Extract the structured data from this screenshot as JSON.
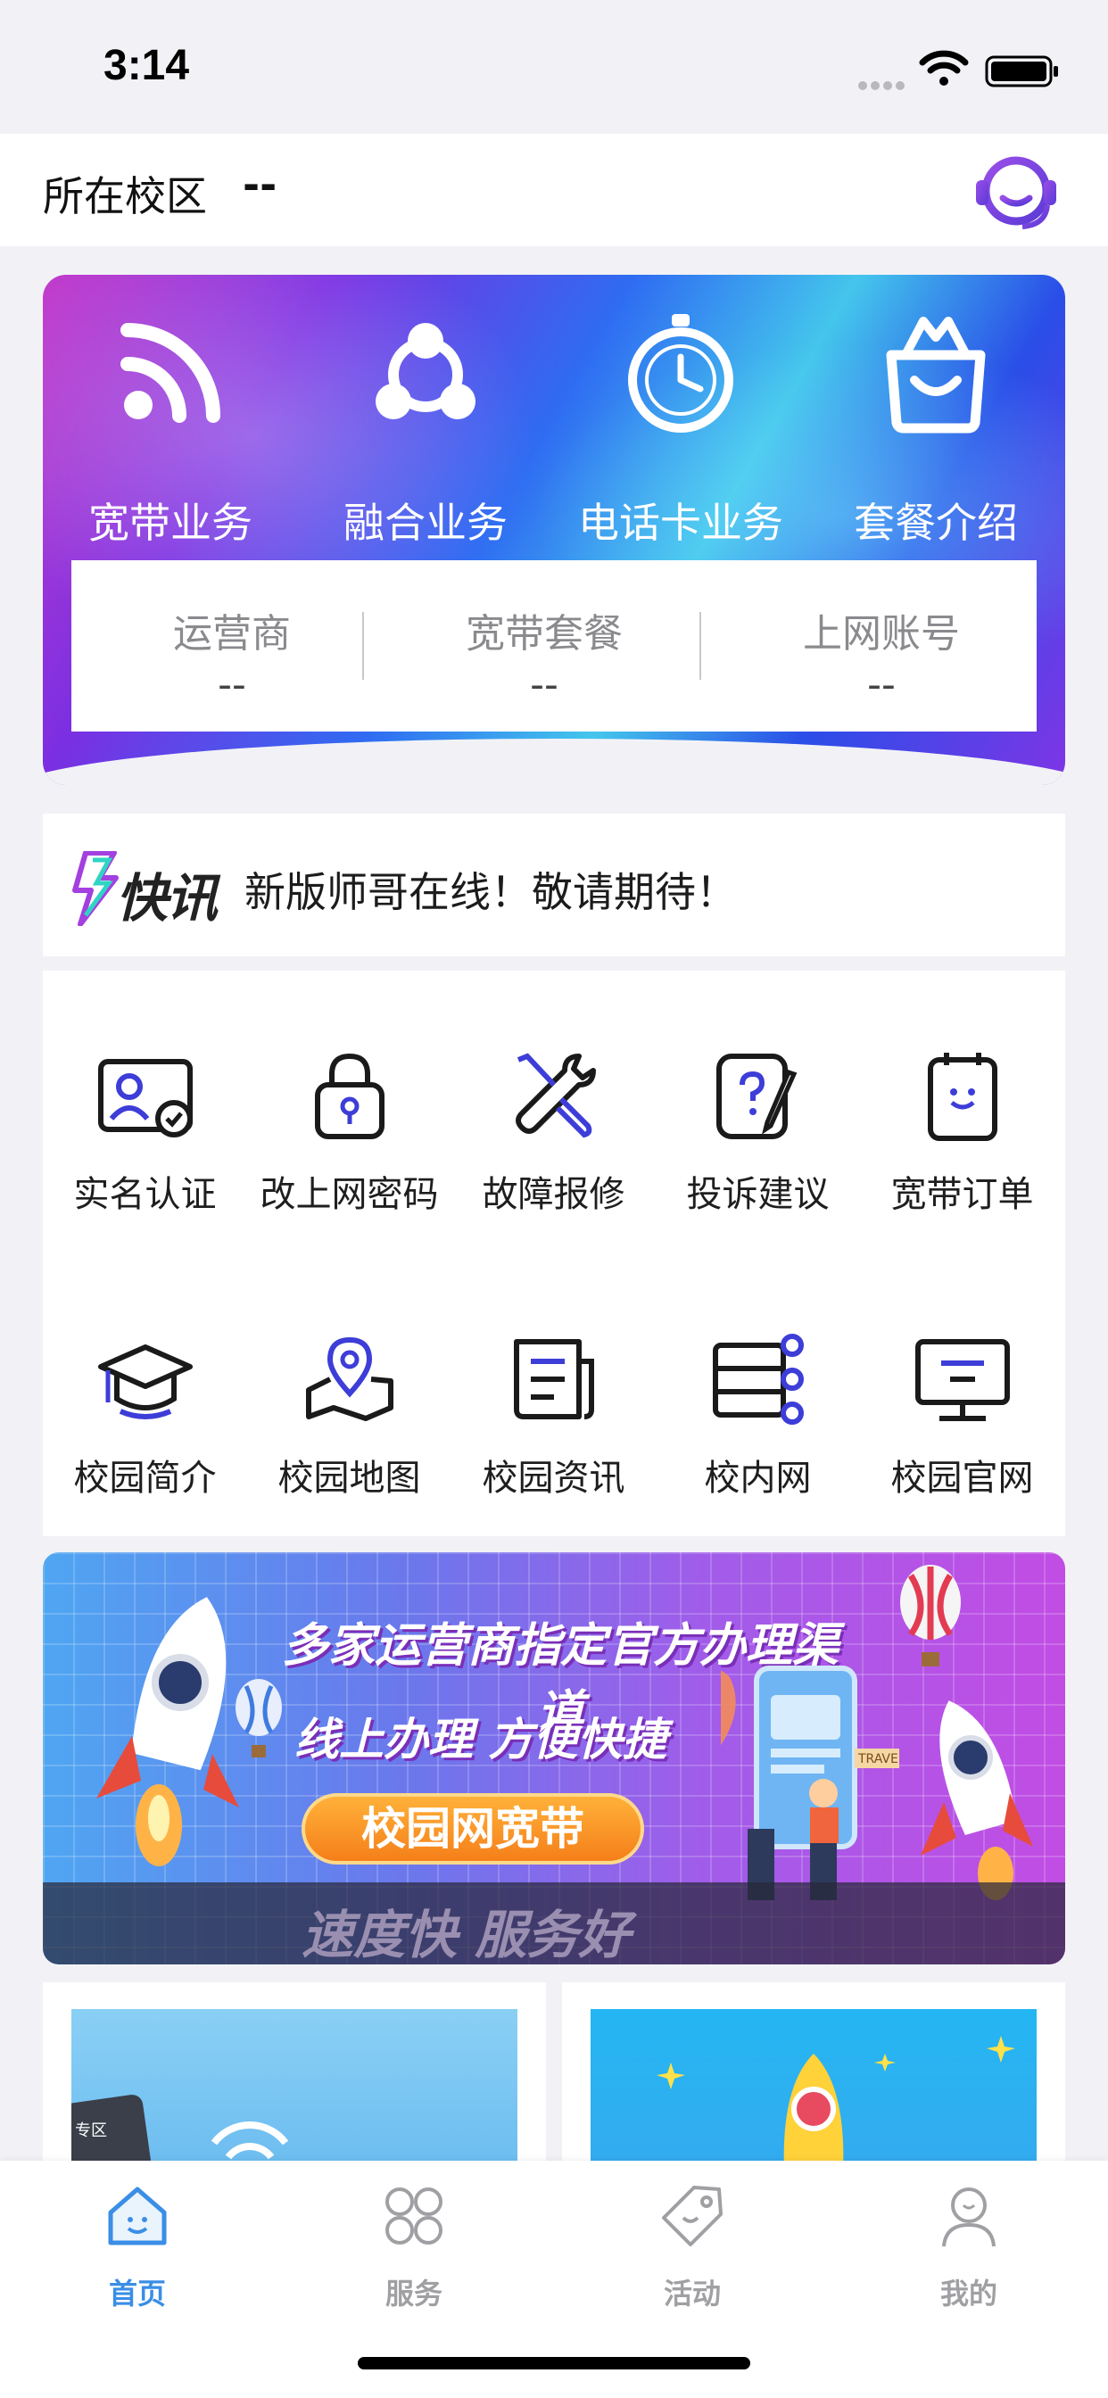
{
  "status_bar": {
    "time": "3:14"
  },
  "campus": {
    "label": "所在校区",
    "value": "--",
    "support_icon": "customer-service-icon"
  },
  "hero": {
    "categories": [
      {
        "label": "宽带业务",
        "icon": "wifi-signal-icon"
      },
      {
        "label": "融合业务",
        "icon": "share-nodes-icon"
      },
      {
        "label": "电话卡业务",
        "icon": "stopwatch-icon"
      },
      {
        "label": "套餐介绍",
        "icon": "shopping-bag-icon"
      }
    ],
    "account": [
      {
        "key": "运营商",
        "value": "--"
      },
      {
        "key": "宽带套餐",
        "value": "--"
      },
      {
        "key": "上网账号",
        "value": "--"
      }
    ]
  },
  "news": {
    "logo_text": "快讯",
    "text": "新版师哥在线！敬请期待！"
  },
  "services": [
    {
      "label": "实名认证",
      "icon": "id-card-icon"
    },
    {
      "label": "改上网密码",
      "icon": "lock-icon"
    },
    {
      "label": "故障报修",
      "icon": "repair-tools-icon"
    },
    {
      "label": "投诉建议",
      "icon": "feedback-edit-icon"
    },
    {
      "label": "宽带订单",
      "icon": "order-clipboard-icon"
    },
    {
      "label": "校园简介",
      "icon": "graduation-cap-icon"
    },
    {
      "label": "校园地图",
      "icon": "map-pin-icon"
    },
    {
      "label": "校园资讯",
      "icon": "news-document-icon"
    },
    {
      "label": "校内网",
      "icon": "server-network-icon"
    },
    {
      "label": "校园官网",
      "icon": "monitor-icon"
    }
  ],
  "promo": {
    "line1": "多家运营商指定官方办理渠道",
    "line2": "线上办理 方便快捷",
    "pill": "校园网宽带",
    "strip": "速度快 服务好",
    "travel_tag": "TRAVEL"
  },
  "cards": {
    "card1_tag": "专区"
  },
  "tabbar": {
    "active_color": "#3a8ee6",
    "inactive_color": "#a0a0a4",
    "tabs": [
      {
        "label": "首页",
        "icon": "home-icon",
        "active": true
      },
      {
        "label": "服务",
        "icon": "services-clover-icon",
        "active": false
      },
      {
        "label": "活动",
        "icon": "price-tag-icon",
        "active": false
      },
      {
        "label": "我的",
        "icon": "profile-person-icon",
        "active": false
      }
    ]
  }
}
